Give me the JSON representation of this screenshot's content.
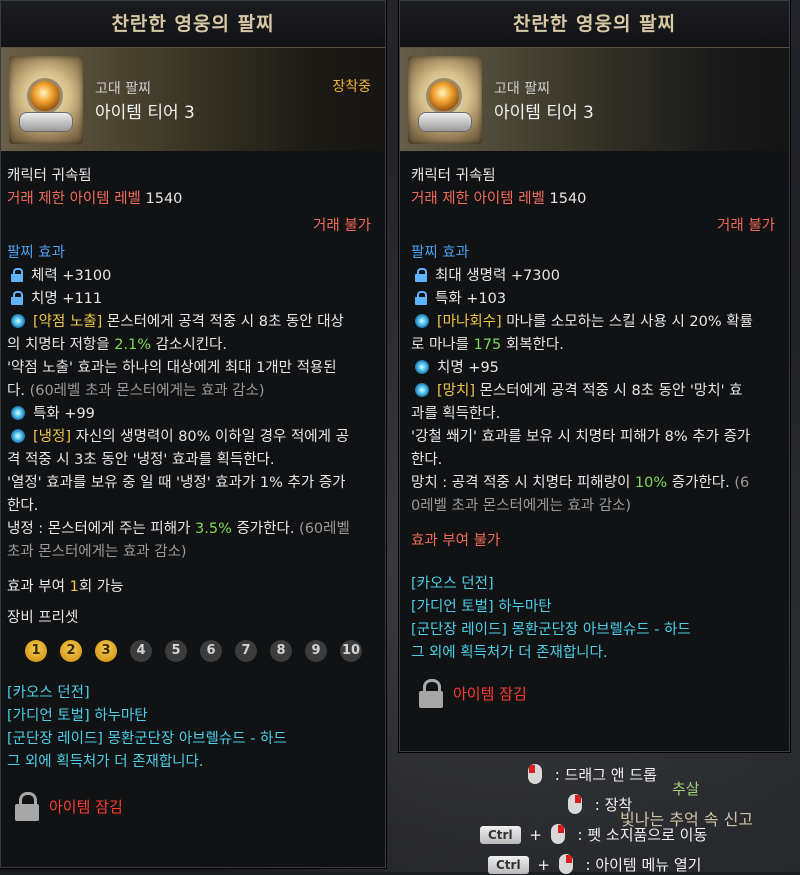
{
  "left": {
    "title": "찬란한 영웅의 팔찌",
    "grade": "고대 팔찌",
    "tier": "아이템 티어 3",
    "equipped": "장착중",
    "bound": "캐릭터 귀속됨",
    "trade_level_label": "거래 제한 아이템 레벨",
    "trade_level_value": "1540",
    "trade_status": "거래 불가",
    "effect_header": "팔찌 효과",
    "stat1": "체력 +3100",
    "stat2": "치명 +111",
    "eff1_tag": "[약점 노출]",
    "eff1_text_a": " 몬스터에게 공격 적중 시 8초 동안 대상",
    "eff1_text_b1": "의 치명타 저항을 ",
    "eff1_pct": "2.1%",
    "eff1_text_b2": " 감소시킨다.",
    "eff1_text_c": "'약점 노출' 효과는 하나의 대상에게 최대 1개만 적용된",
    "eff1_text_d1": "다. ",
    "eff1_text_d2": "(60레벨 초과 몬스터에게는 효과 감소)",
    "stat3": "특화 +99",
    "eff2_tag": "[냉정]",
    "eff2_text_a": " 자신의 생명력이 80% 이하일 경우 적에게 공",
    "eff2_text_b": "격 적중 시 3초 동안 '냉정' 효과를 획득한다.",
    "eff2_text_c": "'열정' 효과를 보유 중 일 때 '냉정' 효과가 1% 추가 증가",
    "eff2_text_d": "한다.",
    "eff2_text_e1": "냉정 : 몬스터에게 주는 피해가 ",
    "eff2_pct": "3.5%",
    "eff2_text_e2": " 증가한다. ",
    "eff2_text_e3": "(60레벨",
    "eff2_text_f": "초과 몬스터에게는 효과 감소)",
    "grant_a": "효과 부여 ",
    "grant_num": "1",
    "grant_b": "회 가능",
    "preset_label": "장비 프리셋",
    "presets": [
      "1",
      "2",
      "3",
      "4",
      "5",
      "6",
      "7",
      "8",
      "9",
      "10"
    ],
    "src1": "[카오스 던전]",
    "src2": "[가디언 토벌] 하누마탄",
    "src3": "[군단장 레이드] 몽환군단장 아브렐슈드 - 하드",
    "src4": "그 외에 획득처가 더 존재합니다.",
    "lock": "아이템 잠김"
  },
  "right": {
    "title": "찬란한 영웅의 팔찌",
    "grade": "고대 팔찌",
    "tier": "아이템 티어 3",
    "bound": "캐릭터 귀속됨",
    "trade_level_label": "거래 제한 아이템 레벨",
    "trade_level_value": "1540",
    "trade_status": "거래 불가",
    "effect_header": "팔찌 효과",
    "stat1": "최대 생명력 +7300",
    "stat2": "특화 +103",
    "eff1_tag": "[마나회수]",
    "eff1_text_a": " 마나를 소모하는 스킬 사용 시 20% 확률",
    "eff1_text_b1": "로 마나를 ",
    "eff1_num": "175",
    "eff1_text_b2": " 회복한다.",
    "stat3": "치명 +95",
    "eff2_tag": "[망치]",
    "eff2_text_a": " 몬스터에게 공격 적중 시 8초 동안 '망치' 효",
    "eff2_text_b": "과를 획득한다.",
    "eff2_text_c": "'강철 쐐기' 효과를 보유 시 치명타 피해가 8% 추가 증가",
    "eff2_text_d": "한다.",
    "eff2_text_e1": "망치 : 공격 적중 시 치명타 피해량이 ",
    "eff2_pct": "10%",
    "eff2_text_e2": " 증가한다. ",
    "eff2_text_e3": "(6",
    "eff2_text_f": "0레벨 초과 몬스터에게는 효과 감소)",
    "grant": "효과 부여 불가",
    "src1": "[카오스 던전]",
    "src2": "[가디언 토벌] 하누마탄",
    "src3": "[군단장 레이드] 몽환군단장 아브렐슈드 - 하드",
    "src4": "그 외에 획득처가 더 존재합니다.",
    "lock": "아이템 잠김"
  },
  "controls": {
    "drag": ": 드래그 앤 드롭",
    "equip": ": 장착",
    "pet_key": "Ctrl",
    "pet": ": 펫 소지품으로 이동",
    "menu_key": "Ctrl",
    "menu": ": 아이템 메뉴 열기",
    "report": "빛나는 추억 속 신고",
    "bg_label": "추살"
  }
}
